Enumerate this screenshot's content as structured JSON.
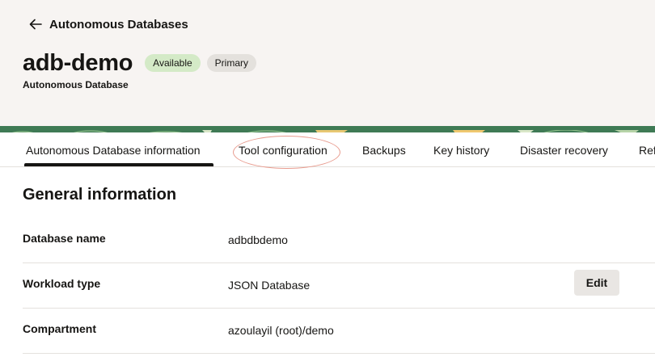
{
  "header": {
    "back_label": "Autonomous Databases",
    "title": "adb-demo",
    "badges": {
      "status": "Available",
      "role": "Primary"
    },
    "subtitle": "Autonomous Database"
  },
  "tabs": [
    {
      "label": "Autonomous Database information",
      "active": true
    },
    {
      "label": "Tool configuration",
      "active": false,
      "highlighted": true
    },
    {
      "label": "Backups",
      "active": false
    },
    {
      "label": "Key history",
      "active": false
    },
    {
      "label": "Disaster recovery",
      "active": false
    },
    {
      "label": "Ref",
      "active": false
    }
  ],
  "section": {
    "title": "General information",
    "rows": [
      {
        "label": "Database name",
        "value": "adbdbdemo"
      },
      {
        "label": "Workload type",
        "value": "JSON Database",
        "action": "Edit"
      },
      {
        "label": "Compartment",
        "value": "azoulayil (root)/demo"
      }
    ]
  },
  "colors": {
    "header_bg": "#f7f4f2",
    "available_badge": "#d4eac7",
    "primary_badge": "#e4e1dd",
    "highlight_oval": "#e89b8e",
    "banner_green": "#3f7a55"
  }
}
